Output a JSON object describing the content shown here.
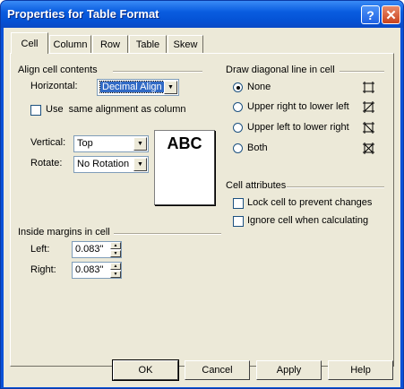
{
  "window": {
    "title": "Properties for Table Format"
  },
  "titlebar": {
    "help_glyph": "?",
    "close_glyph": "✕"
  },
  "tabs": [
    {
      "label": "Cell",
      "active": true
    },
    {
      "label": "Column"
    },
    {
      "label": "Row"
    },
    {
      "label": "Table"
    },
    {
      "label": "Skew"
    }
  ],
  "align": {
    "group_label": "Align cell contents",
    "horizontal_label": "Horizontal:",
    "horizontal_value": "Decimal Align",
    "same_alignment_label": "Use  same alignment as column",
    "same_alignment_checked": false,
    "vertical_label": "Vertical:",
    "vertical_value": "Top",
    "rotate_label": "Rotate:",
    "rotate_value": "No Rotation",
    "preview_text": "ABC"
  },
  "margins": {
    "group_label": "Inside margins in cell",
    "left_label": "Left:",
    "left_value": "0.083\"",
    "right_label": "Right:",
    "right_value": "0.083\""
  },
  "diagonal": {
    "group_label": "Draw diagonal line in cell",
    "options": [
      {
        "label": "None",
        "selected": true,
        "icon": "diagonal-none-icon"
      },
      {
        "label": "Upper right to lower left",
        "selected": false,
        "icon": "diagonal-ur-ll-icon"
      },
      {
        "label": "Upper left to lower right",
        "selected": false,
        "icon": "diagonal-ul-lr-icon"
      },
      {
        "label": "Both",
        "selected": false,
        "icon": "diagonal-both-icon"
      }
    ]
  },
  "attributes": {
    "group_label": "Cell attributes",
    "lock_label": "Lock cell to prevent changes",
    "lock_checked": false,
    "ignore_label": "Ignore cell when calculating",
    "ignore_checked": false
  },
  "buttons": {
    "ok": "OK",
    "cancel": "Cancel",
    "apply": "Apply",
    "help": "Help"
  },
  "colors": {
    "titlebar": "#0a5de0",
    "face": "#ece9d8",
    "selection": "#316ac5"
  }
}
